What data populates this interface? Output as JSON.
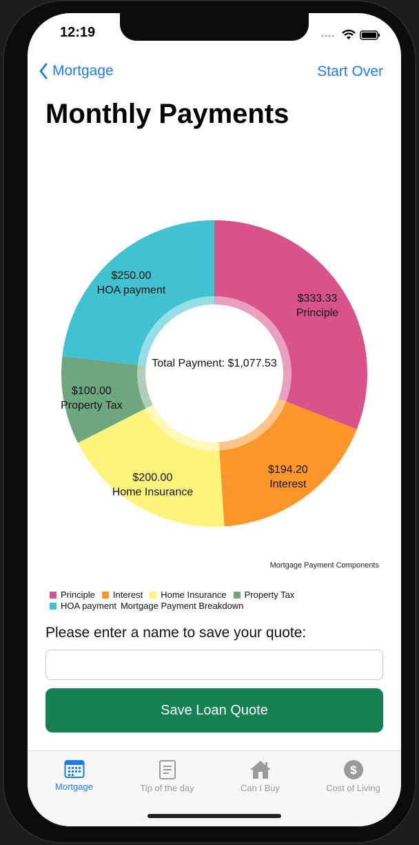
{
  "status": {
    "time": "12:19"
  },
  "nav": {
    "back_label": "Mortgage",
    "right_action": "Start Over"
  },
  "page_title": "Monthly Payments",
  "chart_data": {
    "type": "pie",
    "donut": true,
    "center_label": "Total Payment: $1,077.53",
    "description": "Mortgage Payment Components",
    "slices": [
      {
        "name": "Principle",
        "value": 333.33,
        "label": "$333.33",
        "color": "#d9538b"
      },
      {
        "name": "Interest",
        "value": 194.2,
        "label": "$194.20",
        "color": "#fd9628"
      },
      {
        "name": "Home Insurance",
        "value": 200.0,
        "label": "$200.00",
        "color": "#fef47c"
      },
      {
        "name": "Property Tax",
        "value": 100.0,
        "label": "$100.00",
        "color": "#6ea77f"
      },
      {
        "name": "HOA payment",
        "value": 250.0,
        "label": "$250.00",
        "color": "#41c2d1"
      }
    ],
    "legend_caption": "Mortgage Payment Breakdown"
  },
  "form": {
    "prompt": "Please enter a name to save your quote:",
    "name_value": "",
    "save_label": "Save Loan Quote"
  },
  "tabs": [
    {
      "label": "Mortgage",
      "icon": "calendar-icon",
      "active": true
    },
    {
      "label": "Tip of the day",
      "icon": "document-icon",
      "active": false
    },
    {
      "label": "Can I Buy",
      "icon": "house-icon",
      "active": false
    },
    {
      "label": "Cost of Living",
      "icon": "dollar-icon",
      "active": false
    }
  ],
  "colors": {
    "accent": "#1c7cf4",
    "save_button": "#158052"
  }
}
